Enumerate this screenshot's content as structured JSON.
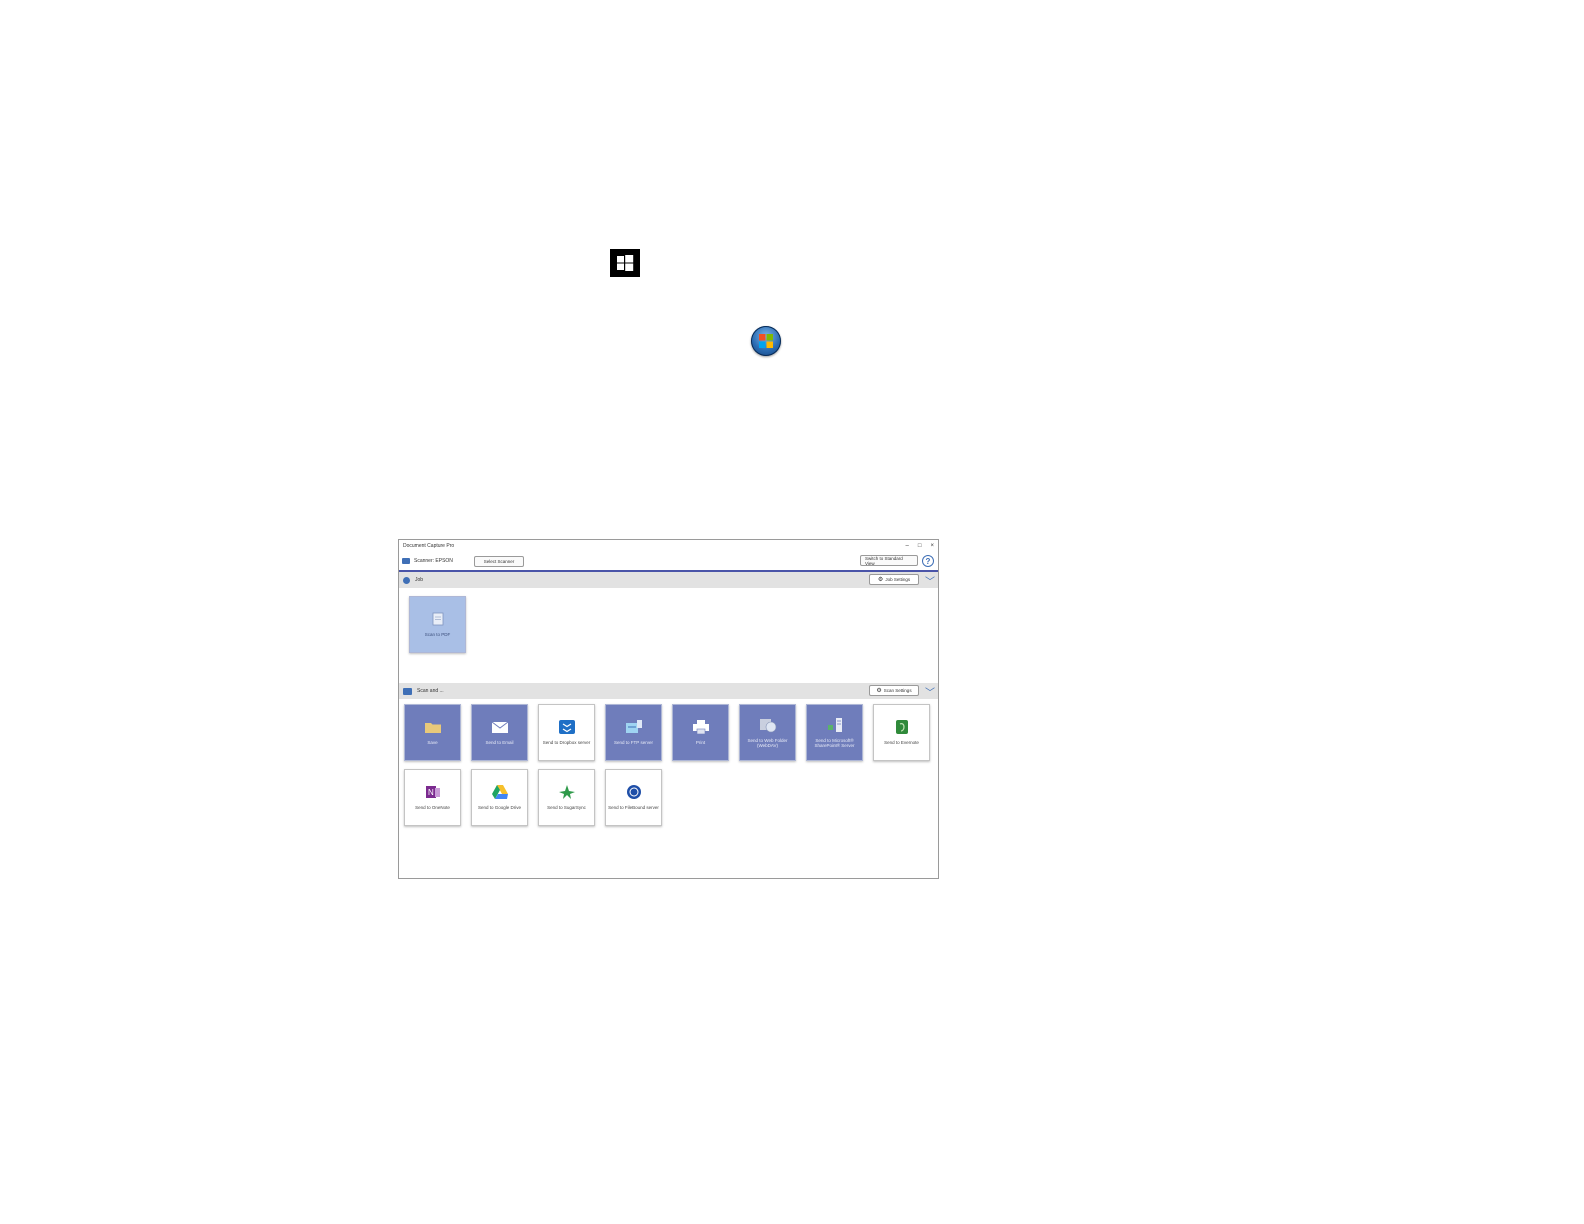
{
  "window": {
    "title": "Document Capture Pro",
    "minimize": "–",
    "maximize": "□",
    "close": "×"
  },
  "toolbar": {
    "scanner_label": "Scanner: EPSON",
    "select_scanner": "Select Scanner",
    "switch_view": "Switch to Standard View",
    "help": "?"
  },
  "job": {
    "header": "Job",
    "settings": "Job Settings",
    "tiles": [
      "Scan to PDF"
    ]
  },
  "scan": {
    "header": "Scan and ...",
    "settings": "Scan Settings",
    "tiles": [
      "Save",
      "Send to Email",
      "Send to Dropbox server",
      "Send to FTP server",
      "Print",
      "Send to Web Folder (WebDAV)",
      "Send to Microsoft® SharePoint® Server",
      "Send to Evernote",
      "Send to OneNote",
      "Send to Google Drive",
      "Send to SugarSync",
      "Send to FileBound server"
    ]
  },
  "colors": {
    "accent": "#4a54a8",
    "tile_blue": "#6f7dbb",
    "tile_selected": "#a9bfe6"
  }
}
